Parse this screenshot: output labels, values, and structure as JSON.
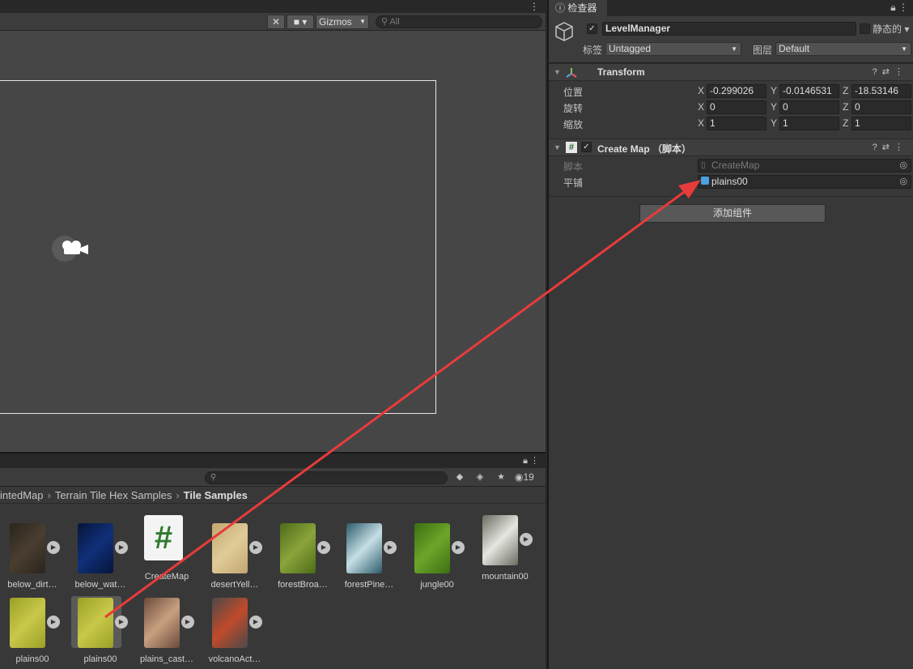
{
  "scene": {
    "toolbar": {
      "gizmos_label": "Gizmos",
      "search_placeholder": "All"
    }
  },
  "project": {
    "hidden_count": "19",
    "breadcrumb": [
      "intedMap",
      "Terrain Tile Hex Samples",
      "Tile Samples"
    ],
    "assets": [
      {
        "label": "below_dirt…",
        "colors": [
          "#2a241d",
          "#4a3e30"
        ]
      },
      {
        "label": "below_wat…",
        "colors": [
          "#06143a",
          "#10307a"
        ]
      },
      {
        "label": "CreateMap",
        "kind": "script",
        "glyph": "#"
      },
      {
        "label": "desertYell…",
        "colors": [
          "#c2a56e",
          "#e0cc98"
        ]
      },
      {
        "label": "forestBroa…",
        "colors": [
          "#4d6b18",
          "#8aa43a"
        ]
      },
      {
        "label": "forestPine…",
        "colors": [
          "#2c5a6a",
          "#c6dfe6"
        ]
      },
      {
        "label": "jungle00",
        "colors": [
          "#3d6e12",
          "#6da52a"
        ]
      },
      {
        "label": "mountain00",
        "colors": [
          "#6a6c60",
          "#e4e6e0"
        ]
      },
      {
        "label": "plains00",
        "colors": [
          "#9aa024",
          "#c8c84a"
        ]
      },
      {
        "label": "plains00",
        "colors": [
          "#9aa024",
          "#c8c84a"
        ],
        "selected": true
      },
      {
        "label": "plains_cast…",
        "colors": [
          "#6b4a3a",
          "#c8a080"
        ]
      },
      {
        "label": "volcanoAct…",
        "colors": [
          "#4a4a4a",
          "#c04a2a"
        ]
      }
    ]
  },
  "inspector": {
    "tab_label": "检查器",
    "object_name": "LevelManager",
    "static_label": "静态的",
    "tag_label": "标签",
    "tag_value": "Untagged",
    "layer_label": "图层",
    "layer_value": "Default",
    "transform": {
      "title": "Transform",
      "rows": [
        {
          "label": "位置",
          "x": "-0.299026",
          "y": "-0.0146531",
          "z": "-18.53146"
        },
        {
          "label": "旋转",
          "x": "0",
          "y": "0",
          "z": "0"
        },
        {
          "label": "缩放",
          "x": "1",
          "y": "1",
          "z": "1"
        }
      ]
    },
    "create_map": {
      "title": "Create Map （脚本）",
      "script_label": "脚本",
      "script_value": "CreateMap",
      "tile_label": "平铺",
      "tile_value": "plains00"
    },
    "add_component_label": "添加组件"
  },
  "colors": {
    "arrow": "#e83b3b",
    "panel": "#383838",
    "scene": "#464646"
  }
}
